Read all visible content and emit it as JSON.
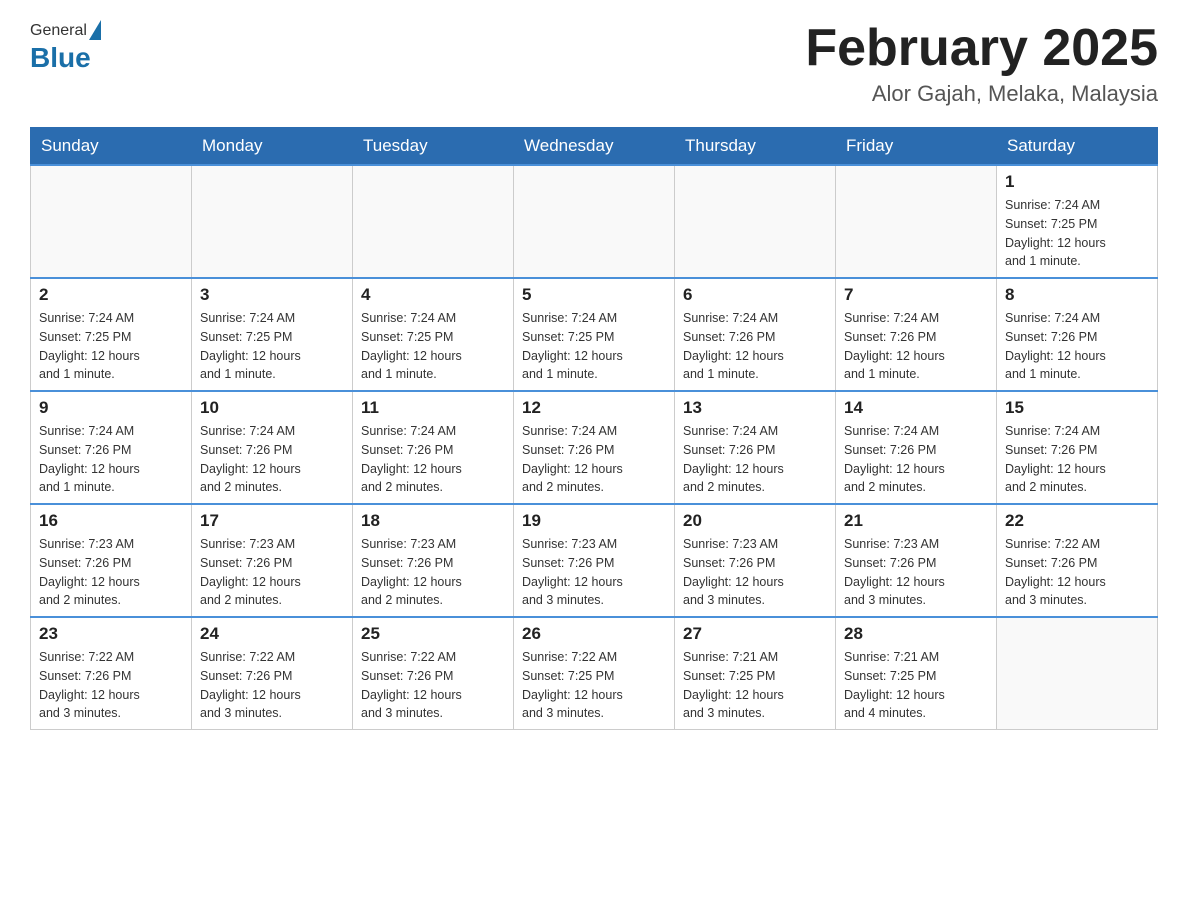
{
  "header": {
    "logo_general": "General",
    "logo_blue": "Blue",
    "month_title": "February 2025",
    "location": "Alor Gajah, Melaka, Malaysia"
  },
  "days_of_week": [
    "Sunday",
    "Monday",
    "Tuesday",
    "Wednesday",
    "Thursday",
    "Friday",
    "Saturday"
  ],
  "weeks": [
    [
      {
        "day": null,
        "info": null
      },
      {
        "day": null,
        "info": null
      },
      {
        "day": null,
        "info": null
      },
      {
        "day": null,
        "info": null
      },
      {
        "day": null,
        "info": null
      },
      {
        "day": null,
        "info": null
      },
      {
        "day": "1",
        "info": "Sunrise: 7:24 AM\nSunset: 7:25 PM\nDaylight: 12 hours\nand 1 minute."
      }
    ],
    [
      {
        "day": "2",
        "info": "Sunrise: 7:24 AM\nSunset: 7:25 PM\nDaylight: 12 hours\nand 1 minute."
      },
      {
        "day": "3",
        "info": "Sunrise: 7:24 AM\nSunset: 7:25 PM\nDaylight: 12 hours\nand 1 minute."
      },
      {
        "day": "4",
        "info": "Sunrise: 7:24 AM\nSunset: 7:25 PM\nDaylight: 12 hours\nand 1 minute."
      },
      {
        "day": "5",
        "info": "Sunrise: 7:24 AM\nSunset: 7:25 PM\nDaylight: 12 hours\nand 1 minute."
      },
      {
        "day": "6",
        "info": "Sunrise: 7:24 AM\nSunset: 7:26 PM\nDaylight: 12 hours\nand 1 minute."
      },
      {
        "day": "7",
        "info": "Sunrise: 7:24 AM\nSunset: 7:26 PM\nDaylight: 12 hours\nand 1 minute."
      },
      {
        "day": "8",
        "info": "Sunrise: 7:24 AM\nSunset: 7:26 PM\nDaylight: 12 hours\nand 1 minute."
      }
    ],
    [
      {
        "day": "9",
        "info": "Sunrise: 7:24 AM\nSunset: 7:26 PM\nDaylight: 12 hours\nand 1 minute."
      },
      {
        "day": "10",
        "info": "Sunrise: 7:24 AM\nSunset: 7:26 PM\nDaylight: 12 hours\nand 2 minutes."
      },
      {
        "day": "11",
        "info": "Sunrise: 7:24 AM\nSunset: 7:26 PM\nDaylight: 12 hours\nand 2 minutes."
      },
      {
        "day": "12",
        "info": "Sunrise: 7:24 AM\nSunset: 7:26 PM\nDaylight: 12 hours\nand 2 minutes."
      },
      {
        "day": "13",
        "info": "Sunrise: 7:24 AM\nSunset: 7:26 PM\nDaylight: 12 hours\nand 2 minutes."
      },
      {
        "day": "14",
        "info": "Sunrise: 7:24 AM\nSunset: 7:26 PM\nDaylight: 12 hours\nand 2 minutes."
      },
      {
        "day": "15",
        "info": "Sunrise: 7:24 AM\nSunset: 7:26 PM\nDaylight: 12 hours\nand 2 minutes."
      }
    ],
    [
      {
        "day": "16",
        "info": "Sunrise: 7:23 AM\nSunset: 7:26 PM\nDaylight: 12 hours\nand 2 minutes."
      },
      {
        "day": "17",
        "info": "Sunrise: 7:23 AM\nSunset: 7:26 PM\nDaylight: 12 hours\nand 2 minutes."
      },
      {
        "day": "18",
        "info": "Sunrise: 7:23 AM\nSunset: 7:26 PM\nDaylight: 12 hours\nand 2 minutes."
      },
      {
        "day": "19",
        "info": "Sunrise: 7:23 AM\nSunset: 7:26 PM\nDaylight: 12 hours\nand 3 minutes."
      },
      {
        "day": "20",
        "info": "Sunrise: 7:23 AM\nSunset: 7:26 PM\nDaylight: 12 hours\nand 3 minutes."
      },
      {
        "day": "21",
        "info": "Sunrise: 7:23 AM\nSunset: 7:26 PM\nDaylight: 12 hours\nand 3 minutes."
      },
      {
        "day": "22",
        "info": "Sunrise: 7:22 AM\nSunset: 7:26 PM\nDaylight: 12 hours\nand 3 minutes."
      }
    ],
    [
      {
        "day": "23",
        "info": "Sunrise: 7:22 AM\nSunset: 7:26 PM\nDaylight: 12 hours\nand 3 minutes."
      },
      {
        "day": "24",
        "info": "Sunrise: 7:22 AM\nSunset: 7:26 PM\nDaylight: 12 hours\nand 3 minutes."
      },
      {
        "day": "25",
        "info": "Sunrise: 7:22 AM\nSunset: 7:26 PM\nDaylight: 12 hours\nand 3 minutes."
      },
      {
        "day": "26",
        "info": "Sunrise: 7:22 AM\nSunset: 7:25 PM\nDaylight: 12 hours\nand 3 minutes."
      },
      {
        "day": "27",
        "info": "Sunrise: 7:21 AM\nSunset: 7:25 PM\nDaylight: 12 hours\nand 3 minutes."
      },
      {
        "day": "28",
        "info": "Sunrise: 7:21 AM\nSunset: 7:25 PM\nDaylight: 12 hours\nand 4 minutes."
      },
      {
        "day": null,
        "info": null
      }
    ]
  ]
}
